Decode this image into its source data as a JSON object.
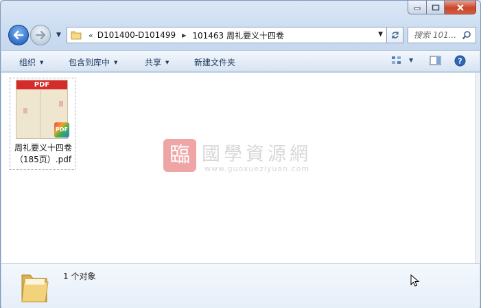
{
  "window": {
    "caption": {
      "minimize_glyph": "▁",
      "maximize_glyph": "☐",
      "close_glyph": "✕"
    }
  },
  "address_bar": {
    "overflow_chevron": "«",
    "crumbs": [
      "D101400-D101499",
      "101463 周礼要义十四卷"
    ]
  },
  "search": {
    "placeholder": "搜索 101..."
  },
  "toolbar": {
    "organize": "组织",
    "include_in_library": "包含到库中",
    "share": "共享",
    "new_folder": "新建文件夹"
  },
  "files": [
    {
      "name": "周礼要义十四卷（185页）.pdf",
      "type": "pdf",
      "thumb_label": "PDF",
      "badge_label": "PDF"
    }
  ],
  "watermark": {
    "seal": "臨",
    "title": "國學資源網",
    "url": "www.guoxueziyuan.com"
  },
  "status": {
    "item_count": "1 个对象"
  },
  "colors": {
    "accent": "#2f6fc9",
    "pdf_red": "#d62b2b",
    "close_red": "#c9462c"
  }
}
